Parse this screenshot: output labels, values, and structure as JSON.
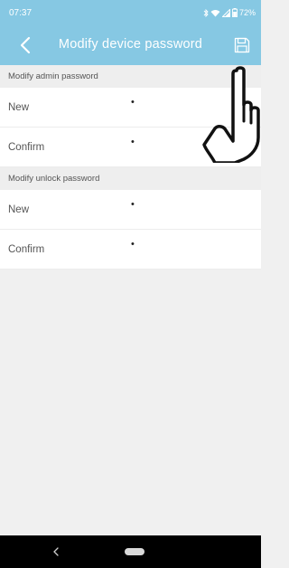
{
  "status_bar": {
    "time": "07:37",
    "battery": "72%"
  },
  "app_bar": {
    "title": "Modify device password",
    "back_icon": "chevron-left-icon",
    "save_icon": "save-icon"
  },
  "sections": [
    {
      "header": "Modify admin password",
      "rows": [
        {
          "label": "New",
          "value": "•"
        },
        {
          "label": "Confirm",
          "value": "•"
        }
      ]
    },
    {
      "header": "Modify unlock password",
      "rows": [
        {
          "label": "New",
          "value": "•"
        },
        {
          "label": "Confirm",
          "value": "•"
        }
      ]
    }
  ],
  "colors": {
    "accent": "#86c8e3",
    "background": "#f0f0f0",
    "nav_bar": "#000000"
  },
  "overlay": {
    "icon": "pointing-hand-icon"
  }
}
